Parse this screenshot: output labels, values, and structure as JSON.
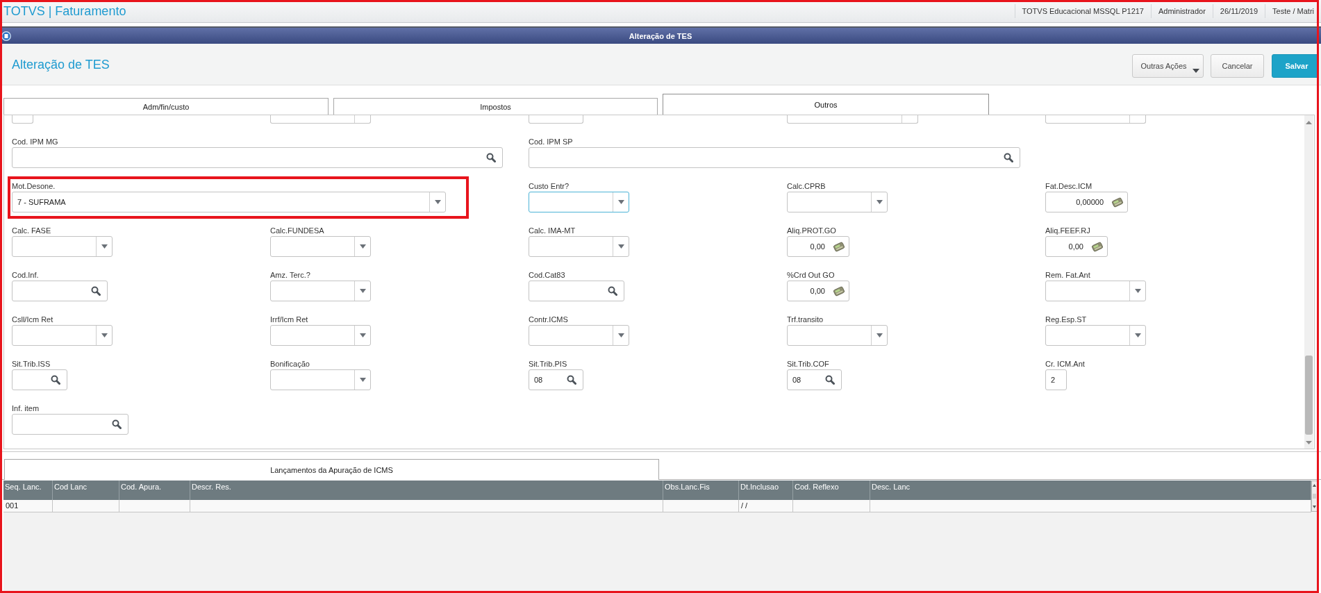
{
  "annotation_frame": true,
  "top_bar": {
    "app_title": "TOTVS | Faturamento",
    "info": [
      "TOTVS Educacional MSSQL P1217",
      "Administrador",
      "26/11/2019",
      "Teste / Matri"
    ]
  },
  "window": {
    "title": "Alteração de TES"
  },
  "page_header": {
    "title": "Alteração de TES",
    "buttons": [
      {
        "label": "Outras Ações",
        "kind": "menu"
      },
      {
        "label": "Cancelar",
        "kind": "secondary"
      },
      {
        "label": "Salvar",
        "kind": "primary"
      }
    ]
  },
  "tabs": [
    {
      "label": "Adm/fin/custo",
      "selected": false
    },
    {
      "label": "Impostos",
      "selected": false
    },
    {
      "label": "Outros",
      "selected": true
    }
  ],
  "form": {
    "partial_row": [
      {
        "kind": "text"
      },
      {
        "kind": "dropdown"
      },
      {
        "kind": "search"
      },
      {
        "kind": "dropdown"
      },
      {
        "kind": "dropdown"
      }
    ],
    "rows": [
      [
        {
          "label": "Cod. IPM MG",
          "kind": "search",
          "focused": false,
          "highlighted": false
        },
        "",
        {
          "label": "Cod. IPM SP",
          "kind": "search",
          "focused": false,
          "highlighted": false
        }
      ],
      [
        {
          "label": "Mot.Desone.",
          "kind": "dropdown",
          "value": "7 - SUFRAMA",
          "focused": false,
          "highlighted": true
        },
        "",
        {
          "label": "Custo Entr?",
          "kind": "dropdown",
          "focused": true,
          "highlighted": false
        },
        {
          "label": "Calc.CPRB",
          "kind": "dropdown",
          "focused": false,
          "highlighted": false
        },
        {
          "label": "Fat.Desc.ICM",
          "kind": "money",
          "value": "0,00000",
          "focused": false,
          "highlighted": false
        }
      ],
      [
        {
          "label": "Calc. FASE",
          "kind": "dropdown",
          "focused": false,
          "highlighted": false
        },
        {
          "label": "Calc.FUNDESA",
          "kind": "dropdown",
          "focused": false,
          "highlighted": false
        },
        {
          "label": "Calc. IMA-MT",
          "kind": "dropdown",
          "focused": false,
          "highlighted": false
        },
        {
          "label": "Aliq.PROT.GO",
          "kind": "money",
          "value": "0,00",
          "focused": false,
          "highlighted": false
        },
        {
          "label": "Aliq.FEEF.RJ",
          "kind": "money",
          "value": "0,00",
          "focused": false,
          "highlighted": false
        }
      ],
      [
        {
          "label": "Cod.Inf.",
          "kind": "search",
          "focused": false,
          "highlighted": false
        },
        {
          "label": "Amz. Terc.?",
          "kind": "dropdown",
          "focused": false,
          "highlighted": false
        },
        {
          "label": "Cod.Cat83",
          "kind": "search",
          "focused": false,
          "highlighted": false
        },
        {
          "label": "%Crd Out GO",
          "kind": "money",
          "value": "0,00",
          "focused": false,
          "highlighted": false
        },
        {
          "label": "Rem. Fat.Ant",
          "kind": "dropdown",
          "focused": false,
          "highlighted": false
        }
      ],
      [
        {
          "label": "Csll/Icm Ret",
          "kind": "dropdown",
          "focused": false,
          "highlighted": false
        },
        {
          "label": "Irrf/Icm Ret",
          "kind": "dropdown",
          "focused": false,
          "highlighted": false
        },
        {
          "label": "Contr.ICMS",
          "kind": "dropdown",
          "focused": false,
          "highlighted": false
        },
        {
          "label": "Trf.transito",
          "kind": "dropdown",
          "focused": false,
          "highlighted": false
        },
        {
          "label": "Reg.Esp.ST",
          "kind": "dropdown",
          "focused": false,
          "highlighted": false
        }
      ],
      [
        {
          "label": "Sit.Trib.ISS",
          "kind": "search",
          "focused": false,
          "highlighted": false
        },
        {
          "label": "Bonificação",
          "kind": "dropdown",
          "focused": false,
          "highlighted": false
        },
        {
          "label": "Sit.Trib.PIS",
          "kind": "search",
          "value": "08",
          "focused": false,
          "highlighted": false
        },
        {
          "label": "Sit.Trib.COF",
          "kind": "search",
          "value": "08",
          "focused": false,
          "highlighted": false
        },
        {
          "label": "Cr. ICM.Ant",
          "kind": "text",
          "value": "2",
          "focused": false,
          "highlighted": false
        }
      ],
      [
        {
          "label": "Inf. item",
          "kind": "search",
          "focused": false,
          "highlighted": false
        }
      ]
    ]
  },
  "detail_tab": {
    "label": "Lançamentos da Apuração de ICMS"
  },
  "table": {
    "columns": [
      "Seq. Lanc.",
      "Cod Lanc",
      "Cod. Apura.",
      "Descr. Res.",
      "Obs.Lanc.Fis",
      "Dt.Inclusao",
      "Cod. Reflexo",
      "Desc. Lanc"
    ],
    "rows": [
      [
        "001",
        null,
        null,
        null,
        null,
        "/ /",
        null,
        null
      ]
    ]
  }
}
